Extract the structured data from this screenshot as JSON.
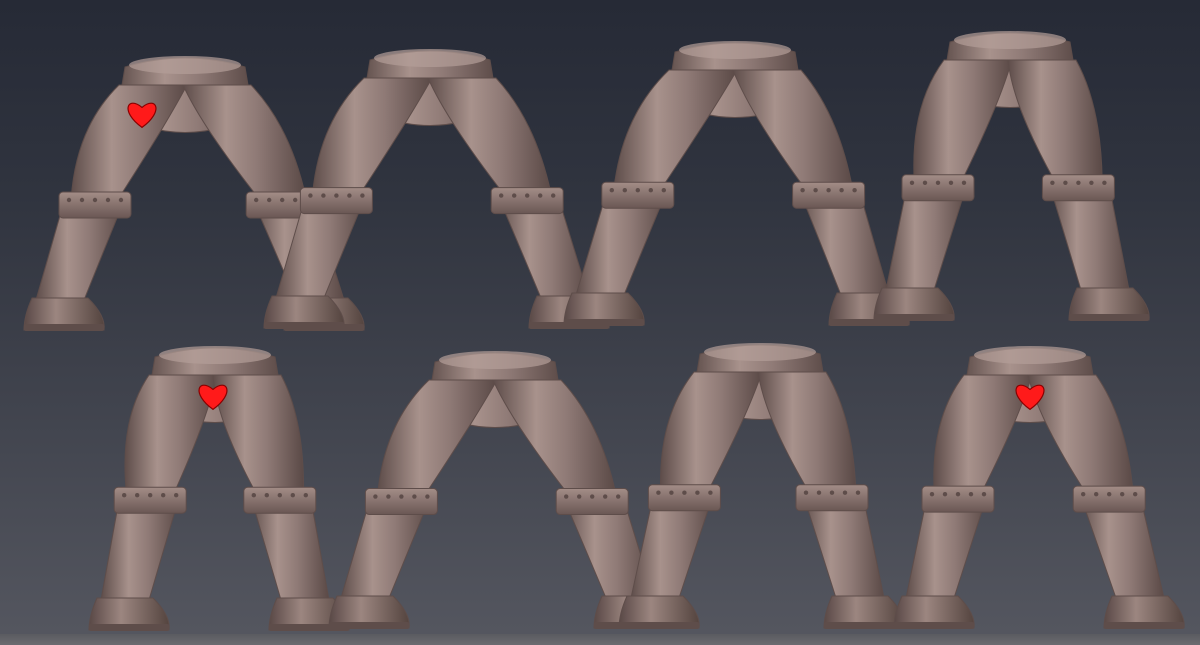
{
  "scene": {
    "background_top": "#262a36",
    "background_bottom": "#555760",
    "sculpt_color": "#8f7a76",
    "sculpt_shadow": "#5e4d4a",
    "sculpt_highlight": "#b39e98",
    "heart_color": "#ff1a1a",
    "heart_outline": "#8a0000"
  },
  "figures": [
    {
      "name": "leg-pair-1",
      "row": 1,
      "has_heart": true
    },
    {
      "name": "leg-pair-2",
      "row": 1,
      "has_heart": false
    },
    {
      "name": "leg-pair-3",
      "row": 1,
      "has_heart": false
    },
    {
      "name": "leg-pair-4",
      "row": 1,
      "has_heart": false
    },
    {
      "name": "leg-pair-5",
      "row": 2,
      "has_heart": true
    },
    {
      "name": "leg-pair-6",
      "row": 2,
      "has_heart": false
    },
    {
      "name": "leg-pair-7",
      "row": 2,
      "has_heart": false
    },
    {
      "name": "leg-pair-8",
      "row": 2,
      "has_heart": true
    }
  ]
}
